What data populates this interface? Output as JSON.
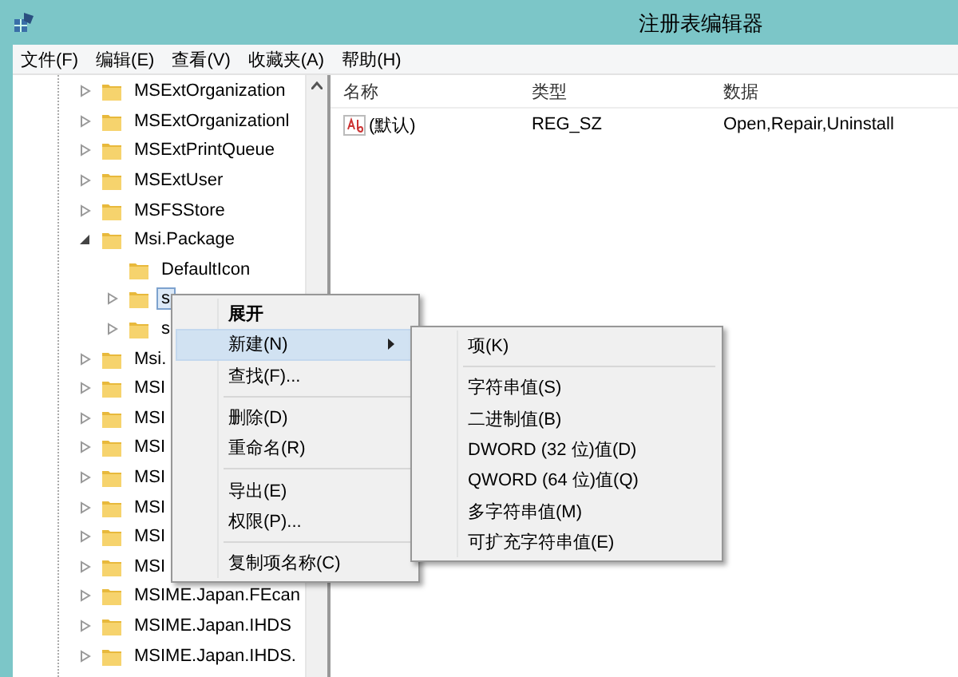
{
  "window": {
    "title": "注册表编辑器"
  },
  "menu_bar": [
    "文件(F)",
    "编辑(E)",
    "查看(V)",
    "收藏夹(A)",
    "帮助(H)"
  ],
  "tree": [
    {
      "label": "MSExtOrganization",
      "expanded": false,
      "selected": false
    },
    {
      "label": "MSExtOrganizationl",
      "expanded": false,
      "selected": false
    },
    {
      "label": "MSExtPrintQueue",
      "expanded": false,
      "selected": false
    },
    {
      "label": "MSExtUser",
      "expanded": false,
      "selected": false
    },
    {
      "label": "MSFSStore",
      "expanded": false,
      "selected": false
    },
    {
      "label": "Msi.Package",
      "expanded": true,
      "selected": false,
      "children": [
        {
          "label": "DefaultIcon",
          "selected": false
        },
        {
          "label": "s",
          "expanded": false,
          "selected": true
        },
        {
          "label": "s",
          "expanded": false,
          "selected": false
        }
      ]
    },
    {
      "label": "Msi.",
      "expanded": false,
      "selected": false
    },
    {
      "label": "MSI",
      "expanded": false,
      "selected": false
    },
    {
      "label": "MSI",
      "expanded": false,
      "selected": false
    },
    {
      "label": "MSI",
      "expanded": false,
      "selected": false
    },
    {
      "label": "MSI",
      "expanded": false,
      "selected": false
    },
    {
      "label": "MSI",
      "expanded": false,
      "selected": false
    },
    {
      "label": "MSI",
      "expanded": false,
      "selected": false
    },
    {
      "label": "MSI",
      "expanded": false,
      "selected": false
    },
    {
      "label": "MSIME.Japan.FEcan",
      "expanded": false,
      "selected": false
    },
    {
      "label": "MSIME.Japan.IHDS",
      "expanded": false,
      "selected": false
    },
    {
      "label": "MSIME.Japan.IHDS.",
      "expanded": false,
      "selected": false
    }
  ],
  "list": {
    "columns": [
      "名称",
      "类型",
      "数据"
    ],
    "rows": [
      {
        "name": "(默认)",
        "type": "REG_SZ",
        "data": "Open,Repair,Uninstall"
      }
    ]
  },
  "context_menu": [
    {
      "kind": "item",
      "label": "展开",
      "bold": true,
      "selected": false
    },
    {
      "kind": "item",
      "label": "新建(N)",
      "selected": true,
      "submenu": true
    },
    {
      "kind": "item",
      "label": "查找(F)...",
      "selected": false
    },
    {
      "kind": "separator"
    },
    {
      "kind": "item",
      "label": "删除(D)",
      "selected": false
    },
    {
      "kind": "item",
      "label": "重命名(R)",
      "selected": false
    },
    {
      "kind": "separator"
    },
    {
      "kind": "item",
      "label": "导出(E)",
      "selected": false
    },
    {
      "kind": "item",
      "label": "权限(P)...",
      "selected": false
    },
    {
      "kind": "separator"
    },
    {
      "kind": "item",
      "label": "复制项名称(C)",
      "selected": false
    }
  ],
  "submenu": [
    {
      "kind": "item",
      "label": "项(K)",
      "selected": false
    },
    {
      "kind": "separator"
    },
    {
      "kind": "item",
      "label": "字符串值(S)",
      "selected": false
    },
    {
      "kind": "item",
      "label": "二进制值(B)",
      "selected": false
    },
    {
      "kind": "item",
      "label": "DWORD (32 位)值(D)",
      "selected": false
    },
    {
      "kind": "item",
      "label": "QWORD (64 位)值(Q)",
      "selected": false
    },
    {
      "kind": "item",
      "label": "多字符串值(M)",
      "selected": false
    },
    {
      "kind": "item",
      "label": "可扩充字符串值(E)",
      "selected": false
    }
  ]
}
